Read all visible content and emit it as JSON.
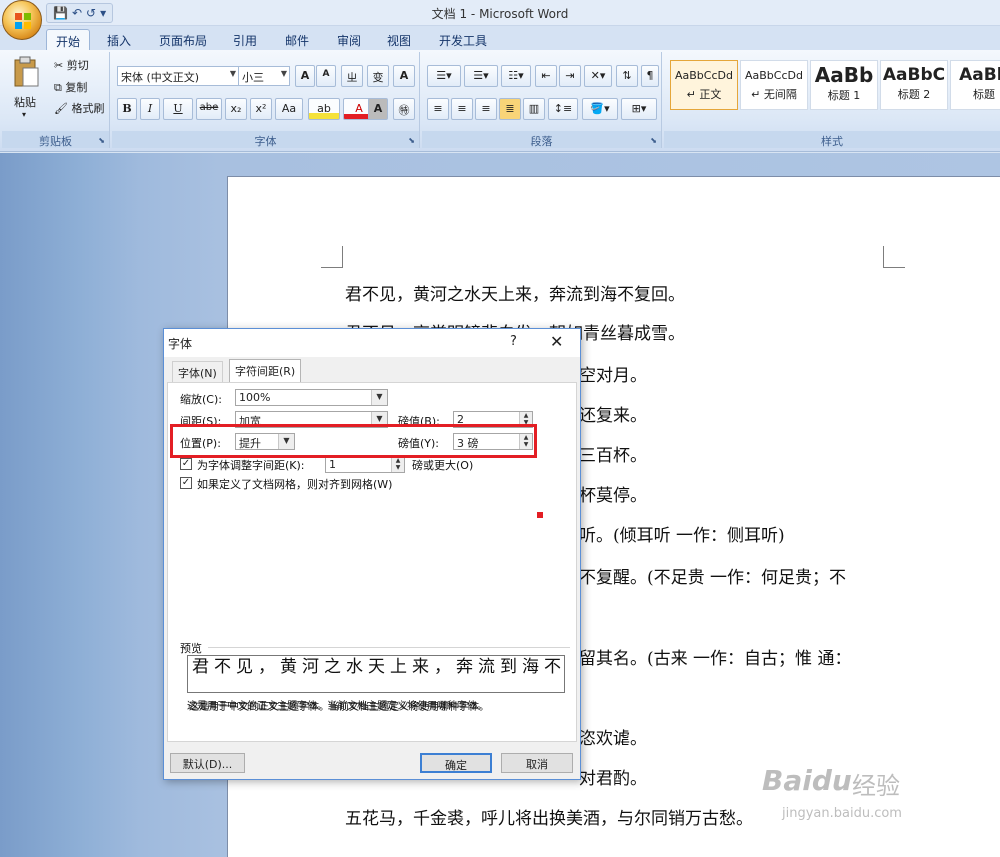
{
  "window": {
    "title": "文档 1 - Microsoft Word"
  },
  "quick_access": {
    "save": "💾",
    "undo": "↶",
    "redo": "↺",
    "more": "▾"
  },
  "tabs": [
    "开始",
    "插入",
    "页面布局",
    "引用",
    "邮件",
    "审阅",
    "视图",
    "开发工具"
  ],
  "clipboard": {
    "paste": "粘贴",
    "cut": "剪切",
    "copy": "复制",
    "format_painter": "格式刷",
    "group": "剪贴板"
  },
  "font": {
    "name": "宋体 (中文正文)",
    "size": "小三",
    "grow": "A",
    "shrink": "A",
    "clear": "Aa",
    "bold": "B",
    "italic": "I",
    "underline": "U",
    "strike": "abe",
    "sub": "x₂",
    "sup": "x²",
    "case": "Aa",
    "highlight": "ab",
    "color": "A",
    "group": "字体"
  },
  "paragraph": {
    "group": "段落"
  },
  "styles": {
    "items": [
      {
        "sample": "AaBbCcDd",
        "name": "↵ 正文"
      },
      {
        "sample": "AaBbCcDd",
        "name": "↵ 无间隔"
      },
      {
        "sample": "AaBb",
        "name": "标题 1"
      },
      {
        "sample": "AaBbC",
        "name": "标题 2"
      },
      {
        "sample": "AaBb",
        "name": "标题"
      }
    ],
    "group": "样式"
  },
  "document_lines": [
    "君不见，黄河之水天上来，奔流到海不复回。",
    "君不见，高堂明镜悲白发，朝如青丝暮成雪。",
    "空对月。",
    "还复来。",
    "三百杯。",
    "杯莫停。",
    "听。(倾耳听 一作：侧耳听)",
    "不复醒。(不足贵 一作：何足贵；不",
    "留其名。(古来 一作：自古；惟 通：",
    "恣欢谑。",
    "对君酌。",
    "五花马，千金裘，呼儿将出换美酒，与尔同销万古愁。"
  ],
  "dialog": {
    "title": "字体",
    "help": "?",
    "close": "✕",
    "tab_font": "字体(N)",
    "tab_spacing": "字符间距(R)",
    "scale_label": "缩放(C):",
    "scale_value": "100%",
    "spacing_label": "间距(S):",
    "spacing_value": "加宽",
    "spacing_by_label": "磅值(B):",
    "spacing_by_value": "2",
    "position_label": "位置(P):",
    "position_value": "提升",
    "position_by_label": "磅值(Y):",
    "position_by_value": "3 磅",
    "kerning_label": "为字体调整字间距(K):",
    "kerning_value": "1",
    "kerning_suffix": "磅或更大(O)",
    "grid_label": "如果定义了文档网格，则对齐到网格(W)",
    "preview_label": "预览",
    "preview_text": "君不见，黄河之水天上来，奔流到海不",
    "preview_note": "这是用于中文的正文主题字体。当前文档主题定义将使用哪种字体。",
    "default_btn": "默认(D)...",
    "ok_btn": "确定",
    "cancel_btn": "取消"
  },
  "watermark": {
    "brand": "Baidu",
    "cn": "经验",
    "url": "jingyan.baidu.com"
  },
  "colors": {
    "highlight_red": "#e31e24",
    "ribbon_blue": "#dbe7f6",
    "accent_orange": "#e5a63a"
  }
}
